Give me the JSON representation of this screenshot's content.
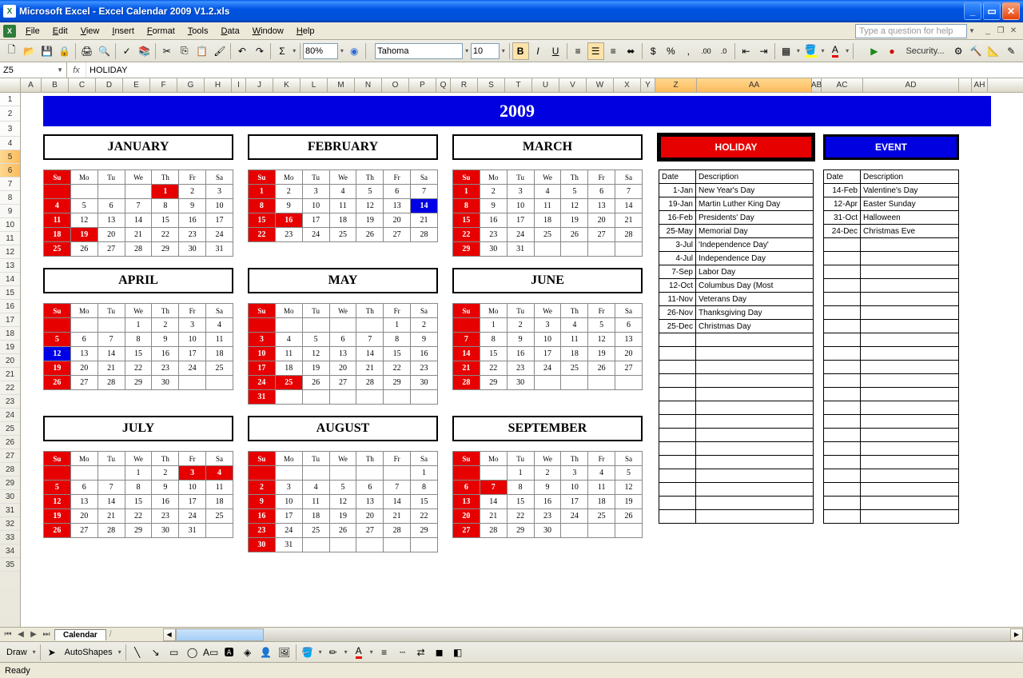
{
  "window": {
    "title": "Microsoft Excel - Excel Calendar 2009 V1.2.xls"
  },
  "menu": [
    "File",
    "Edit",
    "View",
    "Insert",
    "Format",
    "Tools",
    "Data",
    "Window",
    "Help"
  ],
  "helpPlaceholder": "Type a question for help",
  "namebox": "Z5",
  "formula": "HOLIDAY",
  "font": "Tahoma",
  "fontsize": "10",
  "zoom": "80%",
  "columns": [
    {
      "l": "A",
      "w": 26
    },
    {
      "l": "B",
      "w": 34
    },
    {
      "l": "C",
      "w": 34
    },
    {
      "l": "D",
      "w": 34
    },
    {
      "l": "E",
      "w": 34
    },
    {
      "l": "F",
      "w": 34
    },
    {
      "l": "G",
      "w": 34
    },
    {
      "l": "H",
      "w": 34
    },
    {
      "l": "I",
      "w": 18
    },
    {
      "l": "J",
      "w": 34
    },
    {
      "l": "K",
      "w": 34
    },
    {
      "l": "L",
      "w": 34
    },
    {
      "l": "M",
      "w": 34
    },
    {
      "l": "N",
      "w": 34
    },
    {
      "l": "O",
      "w": 34
    },
    {
      "l": "P",
      "w": 34
    },
    {
      "l": "Q",
      "w": 18
    },
    {
      "l": "R",
      "w": 34
    },
    {
      "l": "S",
      "w": 34
    },
    {
      "l": "T",
      "w": 34
    },
    {
      "l": "U",
      "w": 34
    },
    {
      "l": "V",
      "w": 34
    },
    {
      "l": "W",
      "w": 34
    },
    {
      "l": "X",
      "w": 34
    },
    {
      "l": "Y",
      "w": 18
    },
    {
      "l": "Z",
      "w": 52,
      "sel": true
    },
    {
      "l": "AA",
      "w": 144,
      "sel": true
    },
    {
      "l": "AB",
      "w": 12
    },
    {
      "l": "AC",
      "w": 52
    },
    {
      "l": "AD",
      "w": 120
    },
    {
      "l": "",
      "w": 16
    },
    {
      "l": "AH",
      "w": 20
    }
  ],
  "rows": 35,
  "selRows": [
    5,
    6
  ],
  "year": "2009",
  "days": [
    "Su",
    "Mo",
    "Tu",
    "We",
    "Th",
    "Fr",
    "Sa"
  ],
  "months": [
    {
      "name": "JANUARY",
      "start": 4,
      "len": 31,
      "hol": [
        1,
        19
      ]
    },
    {
      "name": "FEBRUARY",
      "start": 0,
      "len": 28,
      "hol": [
        16
      ],
      "evt": [
        14
      ]
    },
    {
      "name": "MARCH",
      "start": 0,
      "len": 31
    },
    {
      "name": "APRIL",
      "start": 3,
      "len": 30,
      "evt": [
        12
      ]
    },
    {
      "name": "MAY",
      "start": 5,
      "len": 31,
      "hol": [
        25
      ]
    },
    {
      "name": "JUNE",
      "start": 1,
      "len": 30
    },
    {
      "name": "JULY",
      "start": 3,
      "len": 31,
      "hol": [
        3,
        4
      ]
    },
    {
      "name": "AUGUST",
      "start": 6,
      "len": 31
    },
    {
      "name": "SEPTEMBER",
      "start": 2,
      "len": 30,
      "hol": [
        7
      ]
    }
  ],
  "holidayHeader": "HOLIDAY",
  "eventHeader": "EVENT",
  "listHdr": {
    "date": "Date",
    "desc": "Description"
  },
  "holidays": [
    {
      "d": "1-Jan",
      "t": "New Year's Day"
    },
    {
      "d": "19-Jan",
      "t": "Martin Luther King Day"
    },
    {
      "d": "16-Feb",
      "t": "Presidents' Day"
    },
    {
      "d": "25-May",
      "t": "Memorial Day"
    },
    {
      "d": "3-Jul",
      "t": "'Independence Day'"
    },
    {
      "d": "4-Jul",
      "t": "Independence Day"
    },
    {
      "d": "7-Sep",
      "t": "Labor Day"
    },
    {
      "d": "12-Oct",
      "t": "Columbus Day (Most"
    },
    {
      "d": "11-Nov",
      "t": "Veterans Day"
    },
    {
      "d": "26-Nov",
      "t": "Thanksgiving Day"
    },
    {
      "d": "25-Dec",
      "t": "Christmas Day"
    }
  ],
  "events": [
    {
      "d": "14-Feb",
      "t": "Valentine's Day"
    },
    {
      "d": "12-Apr",
      "t": "Easter Sunday"
    },
    {
      "d": "31-Oct",
      "t": "Halloween"
    },
    {
      "d": "24-Dec",
      "t": "Christmas Eve"
    }
  ],
  "emptyHolRows": 14,
  "emptyEvtRows": 21,
  "sheetTab": "Calendar",
  "status": "Ready",
  "draw": "Draw",
  "autoshapes": "AutoShapes",
  "security": "Security..."
}
